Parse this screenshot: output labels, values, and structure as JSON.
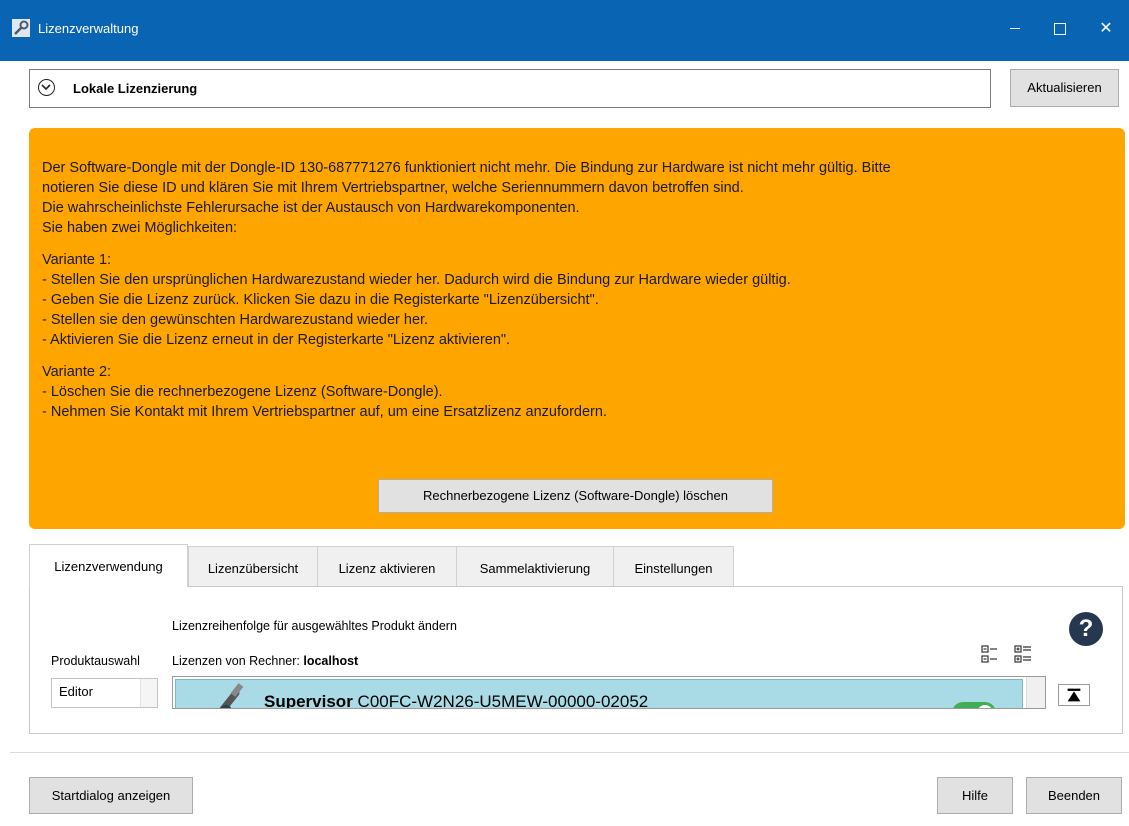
{
  "window": {
    "title": "Lizenzverwaltung",
    "app_icon": "key-wrench-icon"
  },
  "header": {
    "section_title": "Lokale Lizenzierung",
    "refresh_label": "Aktualisieren"
  },
  "warning": {
    "background_color": "#ffa500",
    "lines_a": [
      "Der Software-Dongle mit der Dongle-ID 130-687771276 funktioniert nicht mehr. Die Bindung zur Hardware ist nicht mehr gültig. Bitte",
      "notieren Sie diese ID und klären Sie mit Ihrem Vertriebspartner, welche Seriennummern davon betroffen sind.",
      "Die wahrscheinlichste Fehlerursache ist der Austausch von Hardwarekomponenten.",
      "Sie haben zwei Möglichkeiten:"
    ],
    "lines_b": [
      "Variante 1:",
      "- Stellen Sie den ursprünglichen Hardwarezustand wieder her. Dadurch wird die Bindung zur Hardware wieder gültig.",
      "- Geben Sie die Lizenz zurück. Klicken Sie dazu in die Registerkarte \"Lizenzübersicht\".",
      "- Stellen sie den gewünschten Hardwarezustand wieder her.",
      "- Aktivieren Sie die Lizenz erneut in der Registerkarte \"Lizenz aktivieren\"."
    ],
    "lines_c": [
      "Variante 2:",
      "- Löschen Sie die rechnerbezogene Lizenz (Software-Dongle).",
      "- Nehmen Sie Kontakt mit Ihrem Vertriebspartner auf, um eine Ersatzlizenz anzufordern."
    ],
    "delete_button_label": "Rechnerbezogene Lizenz (Software-Dongle) löschen"
  },
  "tabs": [
    {
      "label": "Lizenzverwendung",
      "active": true
    },
    {
      "label": "Lizenzübersicht",
      "active": false
    },
    {
      "label": "Lizenz aktivieren",
      "active": false
    },
    {
      "label": "Sammelaktivierung",
      "active": false
    },
    {
      "label": "Einstellungen",
      "active": false
    }
  ],
  "panel": {
    "order_label": "Lizenzreihenfolge für ausgewähltes Produkt ändern",
    "product_label": "Produktauswahl",
    "licenses_label": "Lizenzen von Rechner:",
    "host": "localhost",
    "help_icon": "question-circle-icon",
    "products": [
      "Editor"
    ],
    "license_item": {
      "name": "Supervisor",
      "serial": "C00FC-W2N26-U5MEW-00000-02052",
      "enabled": true
    }
  },
  "footer": {
    "start_label": "Startdialog anzeigen",
    "help_label": "Hilfe",
    "exit_label": "Beenden"
  }
}
